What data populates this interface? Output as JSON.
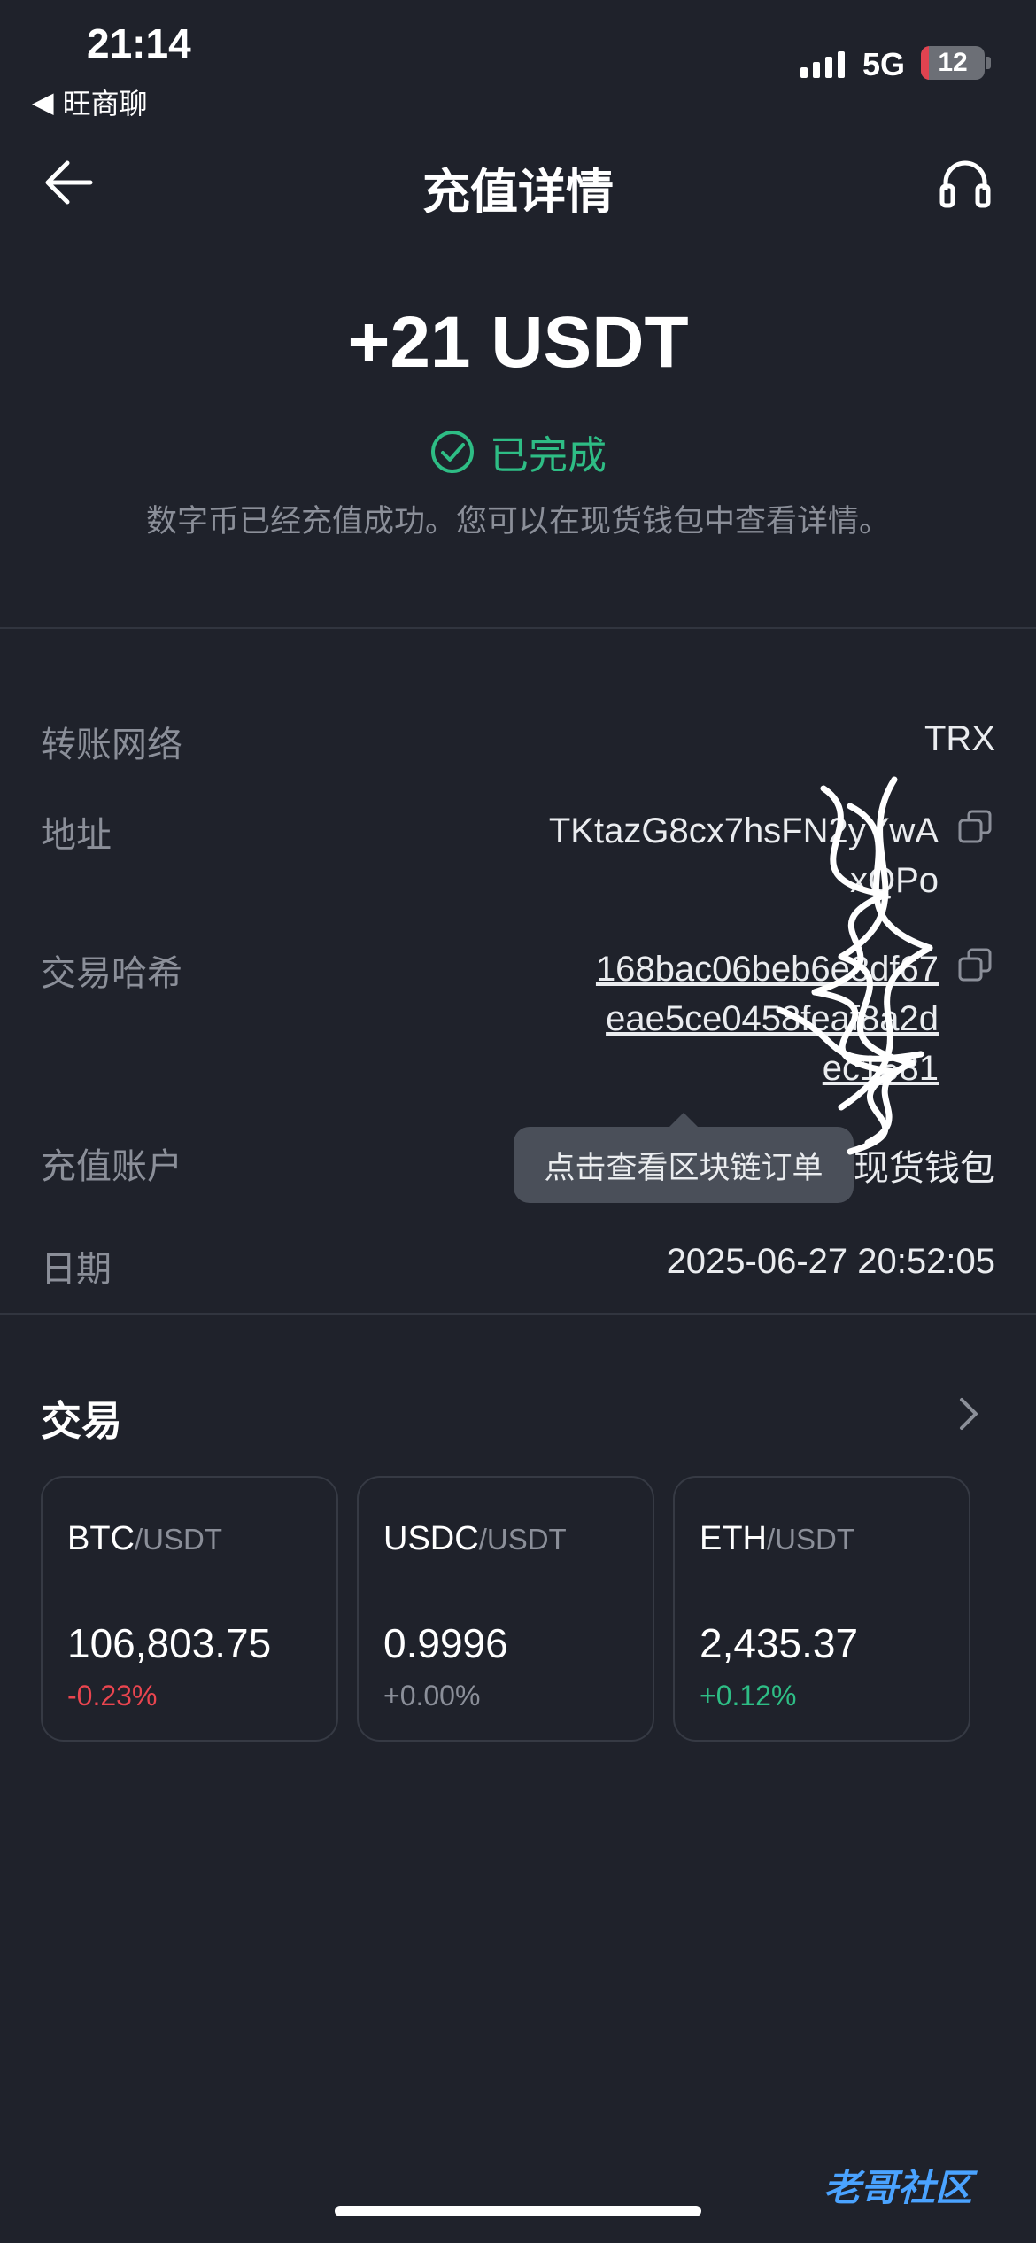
{
  "status_bar": {
    "time": "21:14",
    "back_app": "旺商聊",
    "network": "5G",
    "battery_percent": 12,
    "battery_label": "12"
  },
  "header": {
    "title": "充值详情"
  },
  "summary": {
    "amount": "+21 USDT",
    "status": "已完成",
    "description": "数字币已经充值成功。您可以在现货钱包中查看详情。"
  },
  "details": {
    "network_label": "转账网络",
    "network_value": "TRX",
    "address_label": "地址",
    "address_line1": "TKtazG8cx7hsFN2yYwA",
    "address_line2": "xQPo",
    "hash_label": "交易哈希",
    "hash_line1": "168bac06beb6e8df67",
    "hash_line2": "eae5ce0458feaf8a2d",
    "hash_line3": "ec1681",
    "account_label": "充值账户",
    "account_value": "现货钱包",
    "date_label": "日期",
    "date_value": "2025-06-27 20:52:05"
  },
  "tooltip": {
    "text": "点击查看区块链订单"
  },
  "trade": {
    "title": "交易",
    "cards": [
      {
        "base": "BTC",
        "quote": "/USDT",
        "price": "106,803.75",
        "change": "-0.23%",
        "color": "#e9454f"
      },
      {
        "base": "USDC",
        "quote": "/USDT",
        "price": "0.9996",
        "change": "+0.00%",
        "color": "#8b8f99"
      },
      {
        "base": "ETH",
        "quote": "/USDT",
        "price": "2,435.37",
        "change": "+0.12%",
        "color": "#2ebd85"
      }
    ]
  },
  "colors": {
    "background": "#1f222b",
    "success": "#2ebd85",
    "danger": "#e9454f",
    "muted": "#8b8f99"
  },
  "watermark": "老哥社区"
}
